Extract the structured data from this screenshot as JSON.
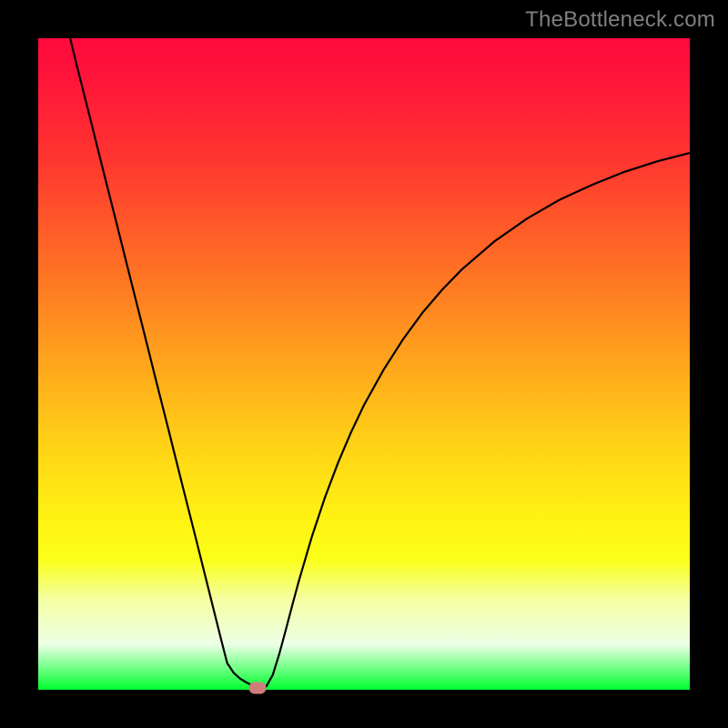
{
  "watermark": "TheBottleneck.com",
  "colors": {
    "frame_background": "#000000",
    "curve_stroke": "#000000",
    "marker_fill": "#cd7e7b",
    "watermark_text": "#7f7f7f",
    "gradient_stops": [
      "#ff0a3e",
      "#ff143a",
      "#ff3430",
      "#ff6f24",
      "#ffa61c",
      "#ffd416",
      "#fff312",
      "#fbff18",
      "#f4ffa0",
      "#edffe6",
      "#00ff2e"
    ]
  },
  "chart_data": {
    "type": "line",
    "title": "",
    "xlabel": "",
    "ylabel": "",
    "xlim": [
      0,
      100
    ],
    "ylim": [
      0,
      100
    ],
    "x": [
      4.9,
      6,
      8,
      10,
      12,
      14,
      16,
      18,
      20,
      22,
      24,
      26,
      28,
      29,
      30,
      31,
      32,
      33,
      33.6,
      34.3,
      35,
      36,
      37,
      38,
      39,
      40,
      42,
      44,
      46,
      48,
      50,
      53,
      56,
      59,
      62,
      65,
      70,
      75,
      80,
      85,
      90,
      95,
      100
    ],
    "values": [
      100,
      95.5,
      87.6,
      79.6,
      71.7,
      63.7,
      55.8,
      47.8,
      39.9,
      31.9,
      24.0,
      16.0,
      8.0,
      4.1,
      2.6,
      1.7,
      1.1,
      0.6,
      0.3,
      0.2,
      0.5,
      2.3,
      5.5,
      9.2,
      13.0,
      16.7,
      23.5,
      29.5,
      34.8,
      39.5,
      43.7,
      49.1,
      53.8,
      57.9,
      61.4,
      64.5,
      68.8,
      72.3,
      75.2,
      77.5,
      79.5,
      81.1,
      82.4
    ],
    "marker": {
      "x": 33.6,
      "y": 0.3
    },
    "grid": false,
    "legend": false
  }
}
